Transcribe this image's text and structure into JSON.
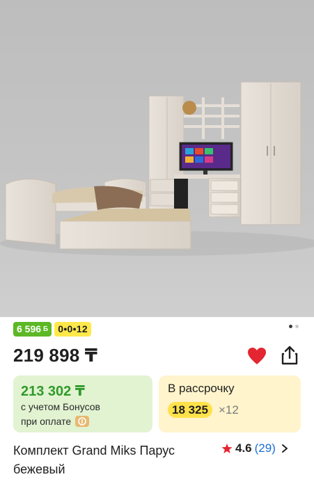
{
  "gallery": {
    "page_indicator": {
      "count": 2,
      "active": 1
    }
  },
  "badges": {
    "bonus": {
      "value": "6 596",
      "symbol": "Б"
    },
    "installment": {
      "value": "0•0•12"
    }
  },
  "price": {
    "main": "219 898 ₸"
  },
  "actions": {
    "favorite_icon": "heart-icon",
    "share_icon": "share-icon"
  },
  "bonus_card": {
    "price": "213 302 ₸",
    "note_line1": "с учетом Бонусов",
    "note_line2": "при оплате"
  },
  "installment_card": {
    "title": "В рассрочку",
    "amount": "18 325",
    "multiplier": "×12"
  },
  "product": {
    "title": "Комплект Grand Miks Парус бежевый",
    "rating": "4.6",
    "reviews": "(29)"
  },
  "colors": {
    "bonus_badge": "#5cb824",
    "installment_badge": "#ffe94a",
    "bonus_price": "#2f9a2b",
    "favorite": "#e32632",
    "review_link": "#1a6fd6"
  }
}
